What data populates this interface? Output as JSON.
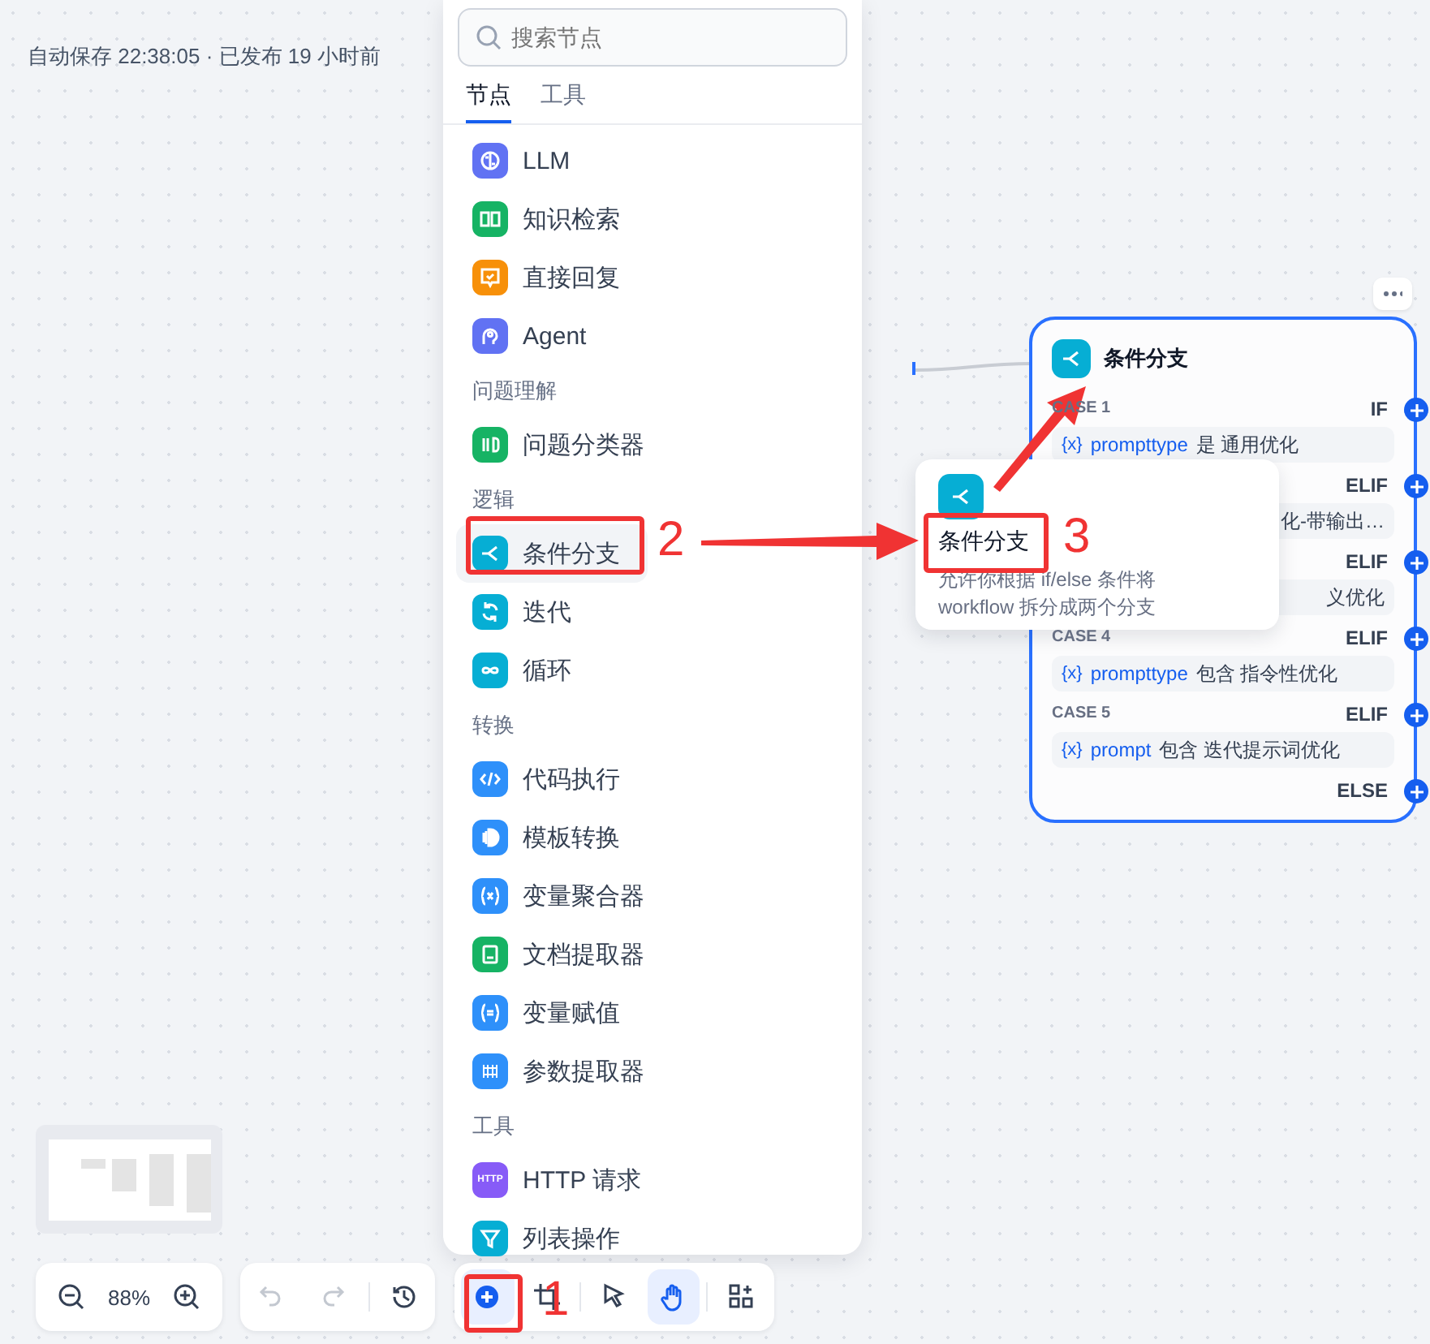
{
  "status": "自动保存 22:38:05 · 已发布 19 小时前",
  "panel": {
    "search": {
      "placeholder": "搜索节点"
    },
    "tabs": [
      {
        "label": "节点",
        "selected": true
      },
      {
        "label": "工具",
        "selected": false
      }
    ],
    "groups": [
      {
        "items": [
          {
            "label": "LLM",
            "color": "#6172f3",
            "selected": false
          },
          {
            "label": "知识检索",
            "color": "#16b364",
            "selected": false
          },
          {
            "label": "直接回复",
            "color": "#f79009",
            "selected": false
          },
          {
            "label": "Agent",
            "color": "#6172f3",
            "selected": false
          }
        ]
      },
      {
        "heading": "问题理解",
        "items": [
          {
            "label": "问题分类器",
            "color": "#16b364",
            "selected": false
          }
        ]
      },
      {
        "heading": "逻辑",
        "items": [
          {
            "label": "条件分支",
            "color": "#06aed4",
            "selected": true
          },
          {
            "label": "迭代",
            "color": "#06aed4",
            "selected": false
          },
          {
            "label": "循环",
            "color": "#06aed4",
            "selected": false
          }
        ]
      },
      {
        "heading": "转换",
        "items": [
          {
            "label": "代码执行",
            "color": "#2e90fa",
            "selected": false
          },
          {
            "label": "模板转换",
            "color": "#2e90fa",
            "selected": false
          },
          {
            "label": "变量聚合器",
            "color": "#2e90fa",
            "selected": false
          },
          {
            "label": "文档提取器",
            "color": "#16b364",
            "selected": false
          },
          {
            "label": "变量赋值",
            "color": "#2e90fa",
            "selected": false
          },
          {
            "label": "参数提取器",
            "color": "#2e90fa",
            "selected": false
          }
        ]
      },
      {
        "heading": "工具",
        "items": [
          {
            "label": "HTTP 请求",
            "color": "#875bf7",
            "selected": false,
            "badge": "HTTP"
          },
          {
            "label": "列表操作",
            "color": "#06aed4",
            "selected": false
          }
        ]
      }
    ]
  },
  "tooltip": {
    "title": "条件分支",
    "description": "允许你根据 if/else 条件将 workflow 拆分成两个分支"
  },
  "node": {
    "title": "条件分支",
    "cases": [
      {
        "label": "CASE 1",
        "type": "IF",
        "var_icon": "{x}",
        "variable": "prompttype",
        "operator": "是",
        "value": "通用优化"
      },
      {
        "type": "ELIF",
        "tail": "化-带输出…"
      },
      {
        "type": "ELIF",
        "tail": "义优化"
      },
      {
        "label": "CASE 4",
        "type": "ELIF",
        "var_icon": "{x}",
        "variable": "prompttype",
        "operator": "包含",
        "value": "指令性优化"
      },
      {
        "label": "CASE 5",
        "type": "ELIF",
        "var_icon": "{x}",
        "variable": "prompt",
        "operator": "包含",
        "value": "迭代提示词优化"
      },
      {
        "type": "ELSE"
      }
    ]
  },
  "zoom": {
    "value": "88%"
  },
  "toolbar": [
    {
      "kind": "add",
      "selected": true
    },
    {
      "kind": "crop",
      "selected": false
    },
    {
      "kind": "pointer",
      "selected": false
    },
    {
      "kind": "hand",
      "selected": true
    },
    {
      "kind": "grid",
      "selected": false
    }
  ],
  "history": [
    {
      "kind": "undo",
      "disabled": true
    },
    {
      "kind": "redo",
      "disabled": true
    },
    {
      "kind": "history",
      "disabled": false
    }
  ],
  "annotations": [
    "1",
    "2",
    "3"
  ]
}
